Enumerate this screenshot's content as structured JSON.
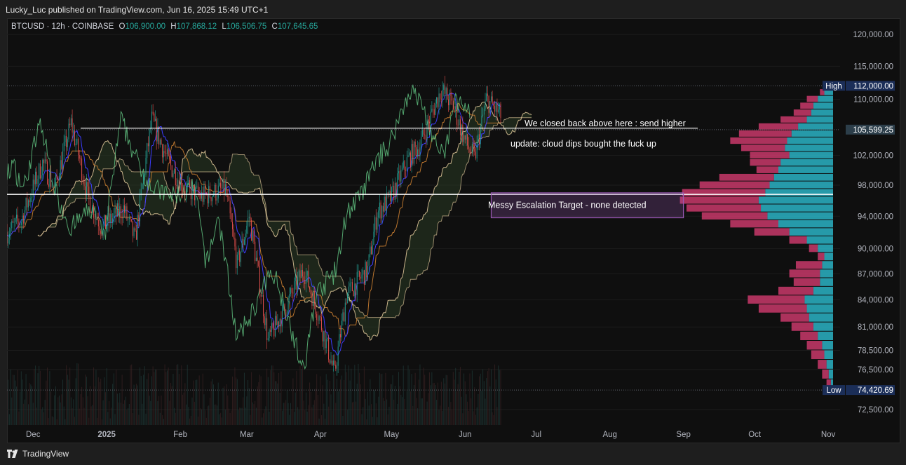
{
  "header": {
    "published": "Lucky_Luc published on TradingView.com, Jun 16, 2025 15:49 UTC+1"
  },
  "legend": {
    "symbol": "BTCUSD · 12h · COINBASE",
    "open_label": "O",
    "open": "106,900.00",
    "high_label": "H",
    "high": "107,868.12",
    "low_label": "L",
    "low": "106,506.75",
    "close_label": "C",
    "close": "107,645.65"
  },
  "footer": {
    "brand": "TradingView"
  },
  "colors": {
    "background": "#0f0f0f",
    "up_bar": "#26a69a",
    "down_bar": "#ef5350",
    "volume_profile_up": "#2ab3c4",
    "volume_profile_down": "#c8386a",
    "tenkan": "#3c3cff",
    "kijun": "#b8742e",
    "lagging": "#5fbf7f",
    "span": "#f5d9a8",
    "target_box": "#9b59b6",
    "label_blue": "#1b2e58"
  },
  "chart_data": {
    "type": "candlestick",
    "symbol": "BTCUSD",
    "interval": "12h",
    "exchange": "COINBASE",
    "x_axis_labels": [
      "Dec",
      "2025",
      "Feb",
      "Mar",
      "Apr",
      "May",
      "Jun",
      "Jul",
      "Aug",
      "Sep",
      "Oct",
      "Nov"
    ],
    "y_axis_labels": [
      "120,000.00",
      "115,000.00",
      "110,000.00",
      "102,000.00",
      "98,000.00",
      "94,000.00",
      "90,000.00",
      "87,000.00",
      "84,000.00",
      "81,000.00",
      "78,500.00",
      "76,500.00",
      "72,500.00"
    ],
    "ylim": [
      71000,
      121500
    ],
    "price_series": [
      {
        "date": "2024-11-20",
        "price": 92000
      },
      {
        "date": "2024-11-26",
        "price": 93500
      },
      {
        "date": "2024-12-05",
        "price": 101000
      },
      {
        "date": "2024-12-10",
        "price": 97500
      },
      {
        "date": "2024-12-17",
        "price": 106500
      },
      {
        "date": "2024-12-24",
        "price": 96500
      },
      {
        "date": "2024-12-30",
        "price": 92500
      },
      {
        "date": "2025-01-08",
        "price": 95000
      },
      {
        "date": "2025-01-13",
        "price": 91000
      },
      {
        "date": "2025-01-20",
        "price": 107000
      },
      {
        "date": "2025-01-27",
        "price": 101000
      },
      {
        "date": "2025-02-03",
        "price": 97500
      },
      {
        "date": "2025-02-10",
        "price": 96500
      },
      {
        "date": "2025-02-20",
        "price": 97500
      },
      {
        "date": "2025-02-25",
        "price": 88000
      },
      {
        "date": "2025-03-02",
        "price": 94000
      },
      {
        "date": "2025-03-10",
        "price": 79500
      },
      {
        "date": "2025-03-17",
        "price": 83000
      },
      {
        "date": "2025-03-25",
        "price": 87500
      },
      {
        "date": "2025-03-31",
        "price": 82500
      },
      {
        "date": "2025-04-07",
        "price": 76000
      },
      {
        "date": "2025-04-12",
        "price": 84500
      },
      {
        "date": "2025-04-21",
        "price": 87500
      },
      {
        "date": "2025-04-25",
        "price": 94500
      },
      {
        "date": "2025-05-01",
        "price": 96500
      },
      {
        "date": "2025-05-08",
        "price": 101500
      },
      {
        "date": "2025-05-13",
        "price": 103500
      },
      {
        "date": "2025-05-22",
        "price": 111500
      },
      {
        "date": "2025-05-27",
        "price": 109000
      },
      {
        "date": "2025-06-01",
        "price": 104000
      },
      {
        "date": "2025-06-05",
        "price": 101500
      },
      {
        "date": "2025-06-10",
        "price": 110000
      },
      {
        "date": "2025-06-16",
        "price": 107645
      }
    ],
    "reference_lines": [
      {
        "label": "High",
        "value": "112,000.00",
        "price": 112000
      },
      {
        "label": "Low",
        "value": "74,420.69",
        "price": 74420.69
      },
      {
        "label": "",
        "value": "105,599.25",
        "price": 105599.25
      }
    ],
    "horizontal_lines": [
      105800,
      96800
    ],
    "annotations": [
      {
        "text": "We closed back above here : send higher",
        "price": 106500
      },
      {
        "text": "update: cloud dips bought the fuck up",
        "price": 103600
      },
      {
        "text": "Messy Escalation Target - none detected",
        "price": 95400
      }
    ],
    "target_zone": {
      "start": "2025-06-12",
      "end": "2025-09-01",
      "price_top": 97000,
      "price_bottom": 93800
    },
    "volume_profile": {
      "price_top": 112000,
      "price_bottom": 74420.69,
      "buckets": [
        {
          "price": 111000,
          "up": 0.04,
          "down": 0.02
        },
        {
          "price": 110000,
          "up": 0.07,
          "down": 0.05
        },
        {
          "price": 109000,
          "up": 0.09,
          "down": 0.06
        },
        {
          "price": 108000,
          "up": 0.1,
          "down": 0.08
        },
        {
          "price": 107000,
          "up": 0.12,
          "down": 0.12
        },
        {
          "price": 106000,
          "up": 0.16,
          "down": 0.18
        },
        {
          "price": 105000,
          "up": 0.19,
          "down": 0.24
        },
        {
          "price": 104000,
          "up": 0.21,
          "down": 0.26
        },
        {
          "price": 103000,
          "up": 0.22,
          "down": 0.2
        },
        {
          "price": 102000,
          "up": 0.2,
          "down": 0.18
        },
        {
          "price": 101000,
          "up": 0.24,
          "down": 0.14
        },
        {
          "price": 100000,
          "up": 0.25,
          "down": 0.1
        },
        {
          "price": 99000,
          "up": 0.27,
          "down": 0.25
        },
        {
          "price": 98000,
          "up": 0.29,
          "down": 0.32
        },
        {
          "price": 97000,
          "up": 0.31,
          "down": 0.38
        },
        {
          "price": 96000,
          "up": 0.34,
          "down": 0.36
        },
        {
          "price": 95000,
          "up": 0.33,
          "down": 0.34
        },
        {
          "price": 94000,
          "up": 0.3,
          "down": 0.3
        },
        {
          "price": 93000,
          "up": 0.25,
          "down": 0.22
        },
        {
          "price": 92000,
          "up": 0.2,
          "down": 0.16
        },
        {
          "price": 91000,
          "up": 0.12,
          "down": 0.08
        },
        {
          "price": 90000,
          "up": 0.07,
          "down": 0.04
        },
        {
          "price": 89000,
          "up": 0.04,
          "down": 0.03
        },
        {
          "price": 88000,
          "up": 0.05,
          "down": 0.12
        },
        {
          "price": 87000,
          "up": 0.06,
          "down": 0.14
        },
        {
          "price": 86000,
          "up": 0.06,
          "down": 0.12
        },
        {
          "price": 85000,
          "up": 0.09,
          "down": 0.16
        },
        {
          "price": 84000,
          "up": 0.13,
          "down": 0.26
        },
        {
          "price": 83000,
          "up": 0.12,
          "down": 0.22
        },
        {
          "price": 82000,
          "up": 0.11,
          "down": 0.13
        },
        {
          "price": 81000,
          "up": 0.09,
          "down": 0.1
        },
        {
          "price": 80000,
          "up": 0.07,
          "down": 0.08
        },
        {
          "price": 79000,
          "up": 0.05,
          "down": 0.07
        },
        {
          "price": 78000,
          "up": 0.04,
          "down": 0.06
        },
        {
          "price": 77000,
          "up": 0.03,
          "down": 0.04
        },
        {
          "price": 76000,
          "up": 0.02,
          "down": 0.03
        },
        {
          "price": 75000,
          "up": 0.01,
          "down": 0.02
        }
      ]
    }
  }
}
